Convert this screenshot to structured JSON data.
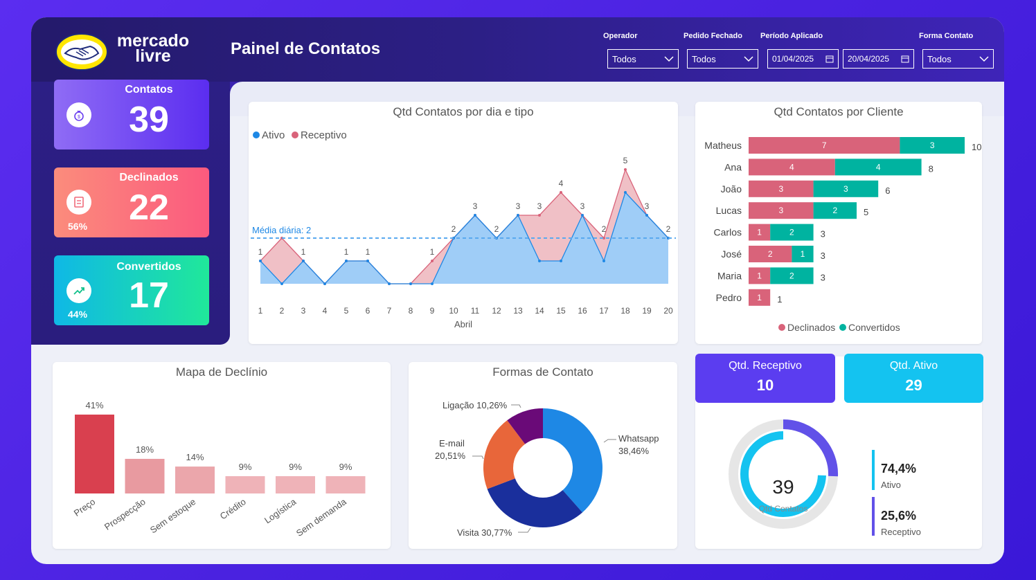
{
  "brand": {
    "logo_line1": "mercado",
    "logo_line2": "livre"
  },
  "header": {
    "title": "Painel de Contatos"
  },
  "filters": {
    "operador": {
      "label": "Operador",
      "value": "Todos"
    },
    "pedido_fechado": {
      "label": "Pedido Fechado",
      "value": "Todos"
    },
    "periodo": {
      "label": "Período Aplicado",
      "start": "01/04/2025",
      "end": "20/04/2025"
    },
    "forma_contato": {
      "label": "Forma Contato",
      "value": "Todos"
    }
  },
  "kpis": {
    "contatos": {
      "label": "Contatos",
      "value": "39",
      "icon": "money-bag-icon"
    },
    "declinados": {
      "label": "Declinados",
      "value": "22",
      "pct": "56%",
      "icon": "invoice-icon"
    },
    "convertidos": {
      "label": "Convertidos",
      "value": "17",
      "pct": "44%",
      "icon": "trend-up-icon"
    }
  },
  "line_chart": {
    "title": "Qtd Contatos por dia e tipo",
    "legend_ativo": "Ativo",
    "legend_receptivo": "Receptivo",
    "media_label": "Média diária: 2",
    "xlabel": "Abril"
  },
  "bar_client": {
    "title": "Qtd Contatos por Cliente",
    "legend_declinados": "Declinados",
    "legend_convertidos": "Convertidos"
  },
  "decline_map": {
    "title": "Mapa de Declínio"
  },
  "forms": {
    "title": "Formas de Contato",
    "labels": {
      "ligacao": "Ligação 10,26%",
      "email_1": "E-mail",
      "email_2": "20,51%",
      "whatsapp_1": "Whatsapp",
      "whatsapp_2": "38,46%",
      "visita": "Visita 30,77%"
    }
  },
  "stats": {
    "receptivo": {
      "label": "Qtd. Receptivo",
      "value": "10"
    },
    "ativo": {
      "label": "Qtd. Ativo",
      "value": "29"
    },
    "donut_total": "39",
    "donut_label": "Qtd Contatos",
    "ativo_pct": "74,4%",
    "ativo_name": "Ativo",
    "receptivo_pct": "25,6%",
    "receptivo_name": "Receptivo"
  },
  "colors": {
    "ativo": "#1e88e5",
    "ativo_fill": "#9fcdf7",
    "receptivo": "#d9637a",
    "receptivo_fill": "#f0c0c6",
    "declinados": "#d9637a",
    "convertidos": "#00b3a0",
    "whatsapp": "#1e88e5",
    "visita": "#1a2f9c",
    "email": "#e8663a",
    "ligacao": "#6a0a78"
  },
  "chart_data": [
    {
      "type": "area",
      "title": "Qtd Contatos por dia e tipo",
      "xlabel": "Abril",
      "x": [
        1,
        2,
        3,
        4,
        5,
        6,
        7,
        8,
        9,
        10,
        11,
        12,
        13,
        14,
        15,
        16,
        17,
        18,
        19,
        20
      ],
      "series": [
        {
          "name": "Ativo",
          "values": [
            1,
            0,
            1,
            0,
            1,
            1,
            0,
            0,
            0,
            2,
            3,
            2,
            3,
            1,
            1,
            3,
            1,
            4,
            3,
            2
          ]
        },
        {
          "name": "Receptivo",
          "values": [
            1,
            2,
            1,
            0,
            1,
            1,
            0,
            0,
            1,
            2,
            3,
            2,
            3,
            3,
            4,
            3,
            2,
            5,
            3,
            2
          ]
        }
      ],
      "labels": [
        1,
        null,
        1,
        null,
        1,
        1,
        null,
        null,
        1,
        2,
        3,
        2,
        3,
        3,
        4,
        3,
        2,
        5,
        3,
        2
      ],
      "average": 2,
      "ylim": [
        0,
        5.5
      ]
    },
    {
      "type": "bar",
      "title": "Qtd Contatos por Cliente",
      "categories": [
        "Matheus",
        "Ana",
        "João",
        "Lucas",
        "Carlos",
        "José",
        "Maria",
        "Pedro"
      ],
      "series": [
        {
          "name": "Declinados",
          "values": [
            7,
            4,
            3,
            3,
            1,
            2,
            1,
            1
          ]
        },
        {
          "name": "Convertidos",
          "values": [
            3,
            4,
            3,
            2,
            2,
            1,
            2,
            0
          ]
        }
      ],
      "totals": [
        10,
        8,
        6,
        5,
        3,
        3,
        3,
        1
      ]
    },
    {
      "type": "bar",
      "title": "Mapa de Declínio",
      "categories": [
        "Preço",
        "Prospecção",
        "Sem estoque",
        "Crédito",
        "Logística",
        "Sem demanda"
      ],
      "values": [
        41,
        18,
        14,
        9,
        9,
        9
      ],
      "value_labels": [
        "41%",
        "18%",
        "14%",
        "9%",
        "9%",
        "9%"
      ]
    },
    {
      "type": "pie",
      "title": "Formas de Contato",
      "categories": [
        "Whatsapp",
        "Visita",
        "E-mail",
        "Ligação"
      ],
      "values": [
        38.46,
        30.77,
        20.51,
        10.26
      ]
    }
  ]
}
